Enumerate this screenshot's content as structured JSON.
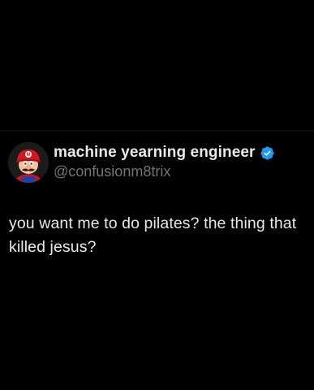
{
  "author": {
    "display_name": "machine yearning engineer",
    "handle": "@confusionm8trix",
    "verified": true,
    "avatar_icon": "red-cap-character-avatar"
  },
  "tweet": {
    "text": "you want me to do pilates? the thing that killed jesus?"
  },
  "colors": {
    "background": "#000000",
    "primary_text": "#e7e9ea",
    "secondary_text": "#71767b",
    "verified_badge": "#1d9bf0"
  }
}
